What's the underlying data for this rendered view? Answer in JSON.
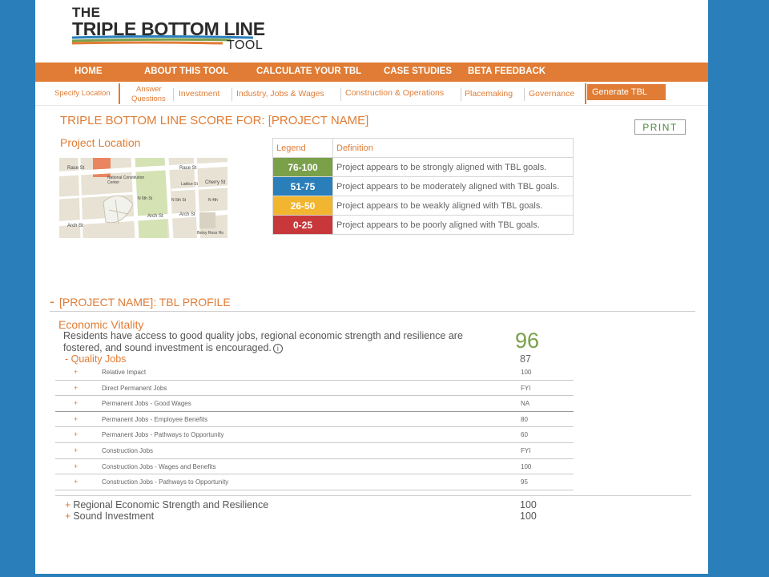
{
  "logo": {
    "line1": "THE",
    "line2": "TRIPLE BOTTOM LINE",
    "line3": "TOOL"
  },
  "nav": [
    "HOME",
    "ABOUT THIS TOOL",
    "CALCULATE YOUR TBL",
    "CASE STUDIES",
    "BETA FEEDBACK"
  ],
  "subnav": {
    "items": [
      "Specify Location",
      "Answer",
      "Questions",
      "Investment",
      "Industry, Jobs & Wages",
      "Construction & Operations",
      "Placemaking",
      "Governance"
    ],
    "generate": "Generate TBL"
  },
  "score_title": "TRIPLE BOTTOM LINE SCORE FOR: [PROJECT NAME]",
  "print": "PRINT",
  "location_title": "Project Location",
  "map": {
    "labels": [
      "Race St",
      "Race St",
      "Cherry St",
      "Arch St",
      "Arch St",
      "Arch St",
      "National Constitution Center",
      "N 6th St",
      "N 5th St",
      "Betsy Ross Ho",
      "Lattice St",
      "N 4th"
    ]
  },
  "legend": {
    "header_legend": "Legend",
    "header_definition": "Definition",
    "rows": [
      {
        "range": "76-100",
        "color": "#7aa04a",
        "definition": "Project appears to be strongly aligned with TBL goals."
      },
      {
        "range": "51-75",
        "color": "#2a7fba",
        "definition": "Project appears to be moderately aligned with TBL goals."
      },
      {
        "range": "26-50",
        "color": "#f2b52f",
        "definition": "Project appears to be weakly aligned with TBL goals."
      },
      {
        "range": "0-25",
        "color": "#c8383a",
        "definition": "Project appears to be poorly aligned with TBL goals."
      }
    ]
  },
  "profile": {
    "title_prefix": "-",
    "title": "[PROJECT NAME]: TBL PROFILE",
    "economic_vitality": {
      "title": "Economic Vitality",
      "description": "Residents have access to good quality jobs, regional economic strength and resilience are fostered, and sound investment is encouraged.",
      "info_icon": "i",
      "score": "96",
      "quality_jobs": {
        "label": "- Quality Jobs",
        "score": "87"
      },
      "rows": [
        {
          "plus": "+",
          "label": "Relative Impact",
          "value": "100"
        },
        {
          "plus": "+",
          "label": "Direct Permanent Jobs",
          "value": "FYI"
        },
        {
          "plus": "+",
          "label": "Permanent Jobs - Good Wages",
          "value": "NA"
        },
        {
          "plus": "+",
          "label": "Permanent Jobs - Employee Benefits",
          "value": "80"
        },
        {
          "plus": "+",
          "label": "Permanent Jobs - Pathways to Opportunity",
          "value": "60"
        },
        {
          "plus": "+",
          "label": "Construction Jobs",
          "value": "FYI"
        },
        {
          "plus": "+",
          "label": "Construction Jobs - Wages and Benefits",
          "value": "100"
        },
        {
          "plus": "+",
          "label": "Construction Jobs - Pathways to Opportunity",
          "value": "95"
        }
      ]
    },
    "sections": [
      {
        "plus": "+",
        "label": "Regional Economic Strength and Resilience",
        "value": "100"
      },
      {
        "plus": "+",
        "label": "Sound Investment",
        "value": "100"
      }
    ]
  }
}
